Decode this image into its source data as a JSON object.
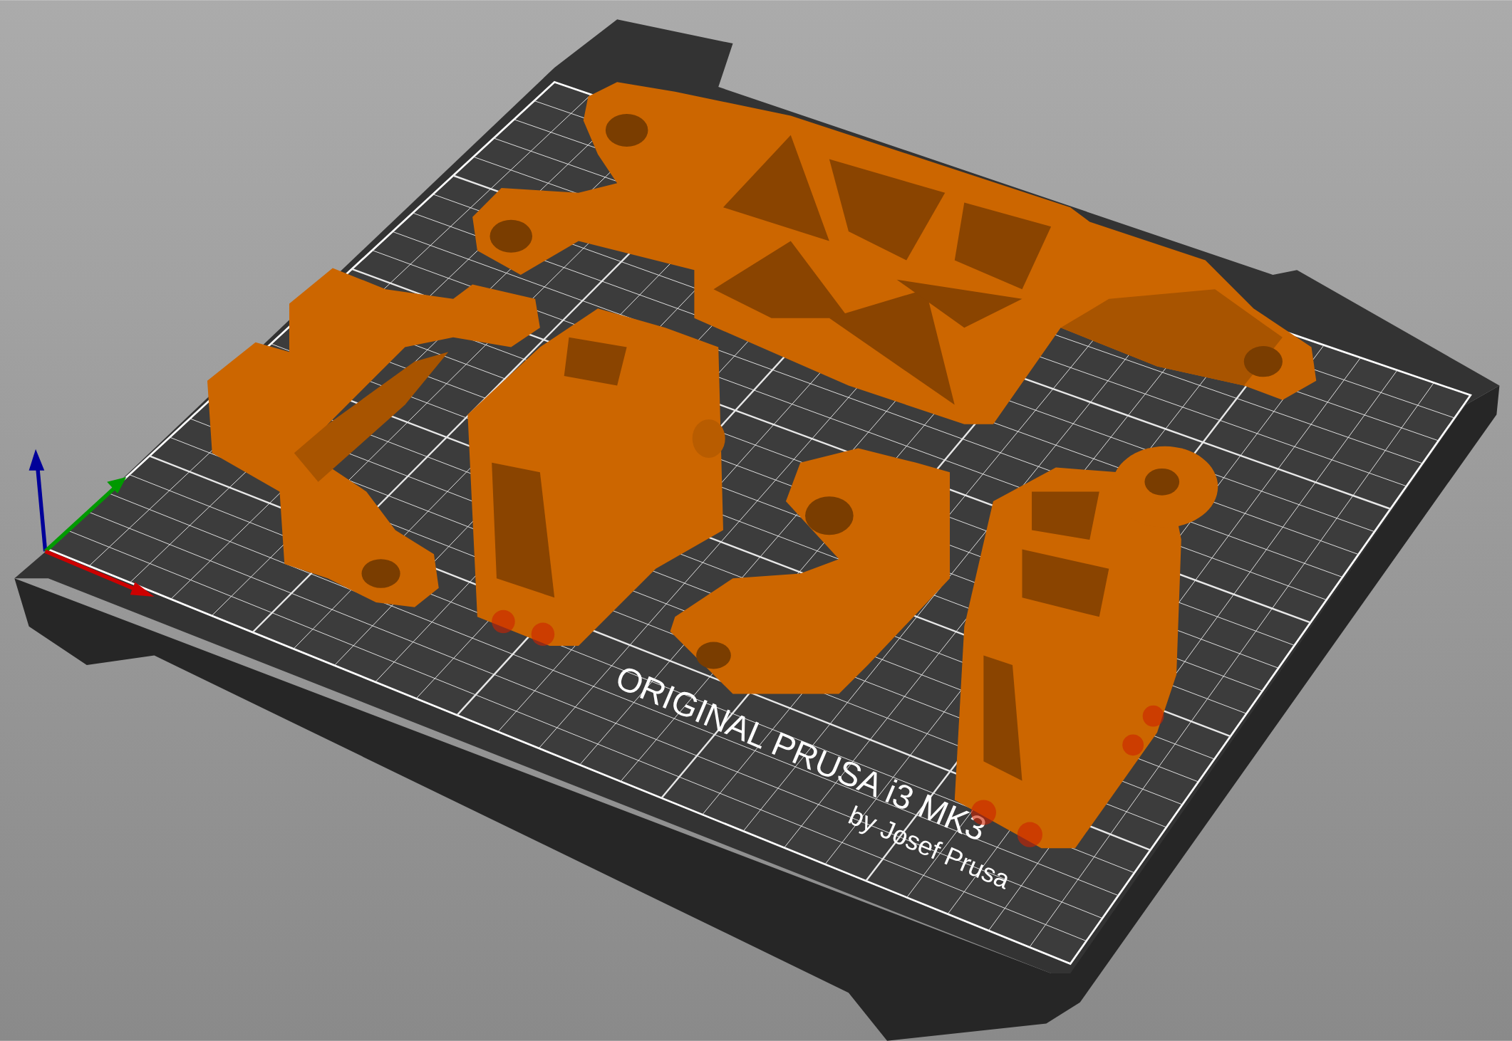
{
  "bed": {
    "label_lines": [
      "ORIGINAL PRUSA i3 MK3",
      "by Josef Prusa"
    ]
  }
}
